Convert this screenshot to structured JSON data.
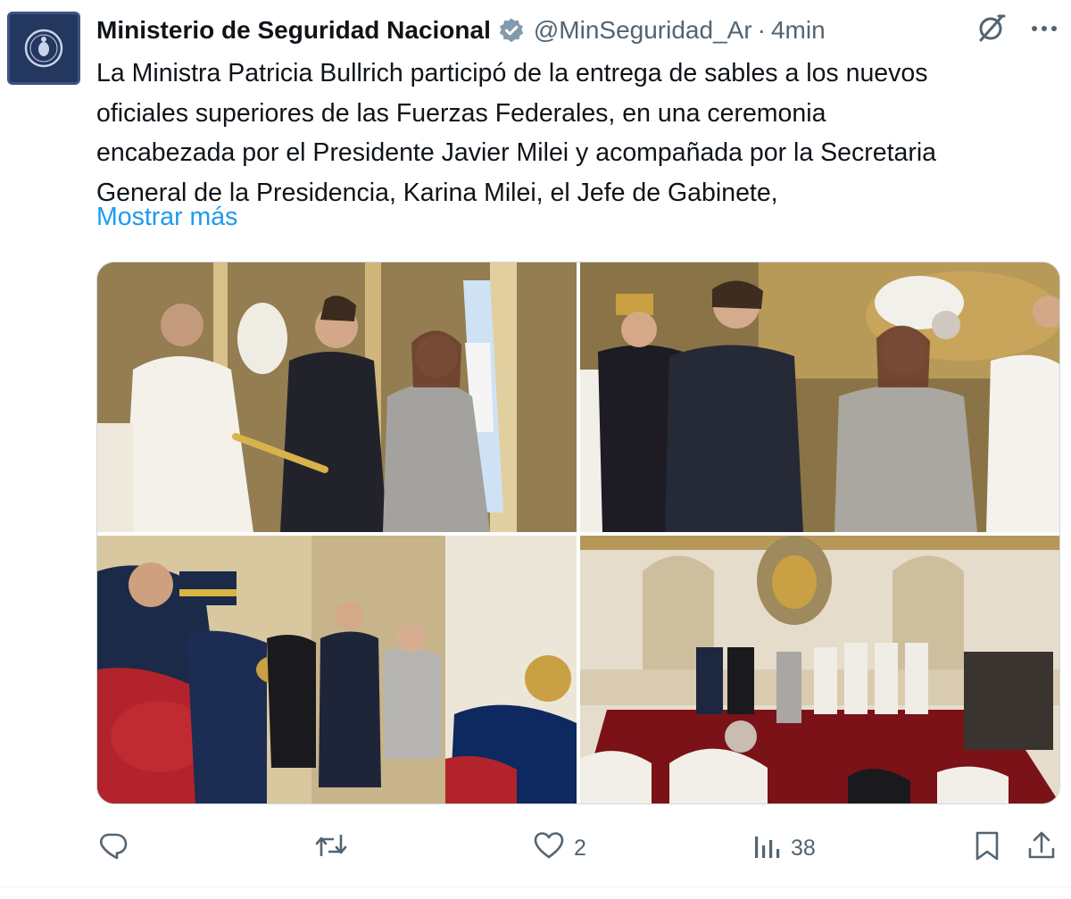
{
  "tweet": {
    "author_name": "Ministerio de Seguridad Nacional",
    "handle": "@MinSeguridad_Ar",
    "separator": "·",
    "time": "4min",
    "text_lines": [
      "La Ministra Patricia Bullrich participó de la entrega de sables a los nuevos",
      "oficiales superiores de las Fuerzas Federales, en una ceremonia",
      "encabezada por el Presidente Javier Milei y acompañada por la Secretaria",
      "General de la Presidencia, Karina Milei, el Jefe de Gabinete,"
    ],
    "show_more": "Mostrar más",
    "photos_count": 4
  },
  "icons": {
    "verified": "verified-badge-icon",
    "grok": "grok-icon",
    "more": "more-options-icon",
    "reply": "reply-icon",
    "retweet": "retweet-icon",
    "like": "like-icon",
    "views": "views-icon",
    "bookmark": "bookmark-icon",
    "share": "share-icon"
  },
  "actions": {
    "reply_count": "",
    "retweet_count": "",
    "like_count": "2",
    "views_count": "38"
  },
  "colors": {
    "text": "#0f1419",
    "secondary": "#536471",
    "link": "#1d9bf0",
    "verified": "#829aab",
    "avatar_bg": "#24375e"
  }
}
